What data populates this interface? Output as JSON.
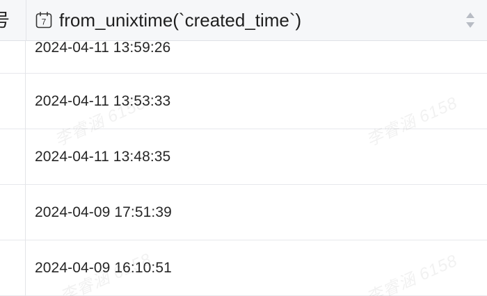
{
  "table": {
    "left_column_header": "号",
    "column_header": "from_unixtime(`created_time`)",
    "column_type_icon_label": "7",
    "rows": [
      {
        "value": "2024-04-11 13:59:26"
      },
      {
        "value": "2024-04-11 13:53:33"
      },
      {
        "value": "2024-04-11 13:48:35"
      },
      {
        "value": "2024-04-09 17:51:39"
      },
      {
        "value": "2024-04-09 16:10:51"
      }
    ]
  },
  "watermark": {
    "text": "李睿涵 6158"
  },
  "icons": {
    "column_type": "calendar-icon",
    "sort": "sort-icon"
  }
}
